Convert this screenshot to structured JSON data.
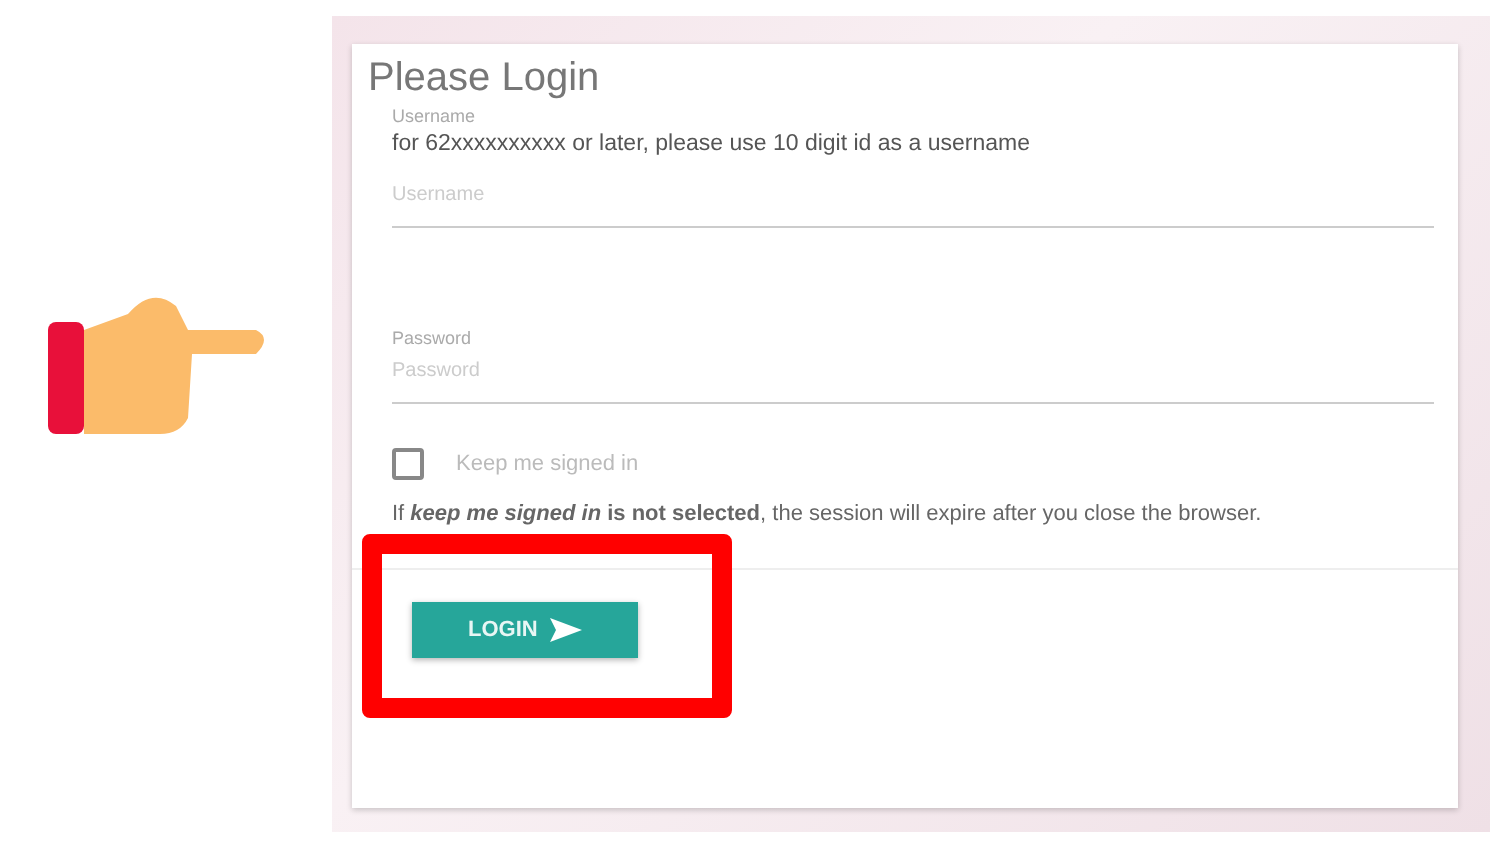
{
  "title": "Please Login",
  "username": {
    "label": "Username",
    "hint": "for 62xxxxxxxxxx or later, please use 10 digit id as a username",
    "placeholder": "Username"
  },
  "password": {
    "label": "Password",
    "placeholder": "Password"
  },
  "remember": {
    "label": "Keep me signed in",
    "checked": false
  },
  "note": "If ***keep me signed in* is not selected**, the session will expire after you close the browser.",
  "login_button": {
    "label": "LOGIN"
  },
  "highlight": true
}
